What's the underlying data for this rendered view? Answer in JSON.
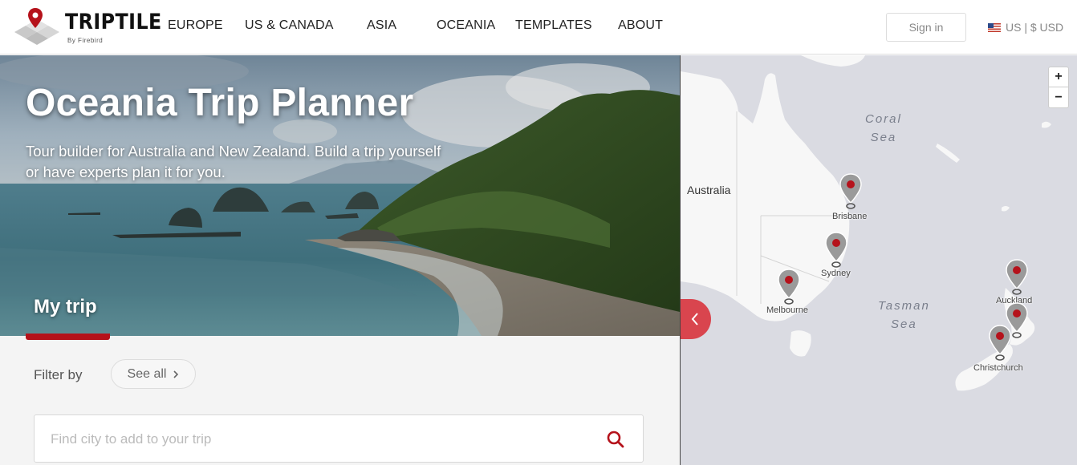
{
  "brand": {
    "name": "TRIPTILE",
    "tagline": "By Firebird",
    "accent": "#b5121b"
  },
  "nav": {
    "items": [
      {
        "label": "EUROPE"
      },
      {
        "label": "US & CANADA"
      },
      {
        "label": "ASIA"
      },
      {
        "label": "OCEANIA"
      },
      {
        "label": "TEMPLATES"
      },
      {
        "label": "ABOUT"
      }
    ],
    "signin_label": "Sign in",
    "locale_label": "US | $ USD"
  },
  "hero": {
    "title": "Oceania Trip Planner",
    "subtitle": "Tour builder for Australia and New Zealand. Build a trip yourself or have experts plan it for you.",
    "section_label": "My trip"
  },
  "filter": {
    "label": "Filter by",
    "see_all_label": "See all"
  },
  "search": {
    "placeholder": "Find city to add to your trip",
    "value": ""
  },
  "map": {
    "country_label": "Australia",
    "seas": [
      {
        "line1": "Coral",
        "line2": "Sea"
      },
      {
        "line1": "Tasman",
        "line2": "Sea"
      }
    ],
    "cities": [
      "Brisbane",
      "Sydney",
      "Melbourne",
      "Auckland",
      "Christchurch"
    ],
    "zoom_in_label": "+",
    "zoom_out_label": "−",
    "pin_color": "#b5121b"
  }
}
